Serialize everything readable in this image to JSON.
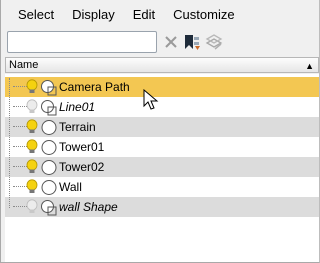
{
  "menu": [
    "Select",
    "Display",
    "Edit",
    "Customize"
  ],
  "search": {
    "value": ""
  },
  "header": {
    "name_label": "Name",
    "sort_icon": "sort-ascending-icon"
  },
  "rows": [
    {
      "name": "Camera Path",
      "italic": false,
      "selected": true,
      "light_on": true,
      "icon": "shape-object-icon"
    },
    {
      "name": "Line01",
      "italic": true,
      "selected": false,
      "light_on": false,
      "icon": "shape-object-icon"
    },
    {
      "name": "Terrain",
      "italic": false,
      "selected": false,
      "light_on": true,
      "icon": "geometry-object-icon"
    },
    {
      "name": "Tower01",
      "italic": false,
      "selected": false,
      "light_on": true,
      "icon": "geometry-object-icon"
    },
    {
      "name": "Tower02",
      "italic": false,
      "selected": false,
      "light_on": true,
      "icon": "geometry-object-icon"
    },
    {
      "name": "Wall",
      "italic": false,
      "selected": false,
      "light_on": true,
      "icon": "geometry-object-icon"
    },
    {
      "name": "wall Shape",
      "italic": true,
      "selected": false,
      "light_on": false,
      "icon": "shape-object-icon"
    }
  ],
  "colors": {
    "selected_row": "#f3c752",
    "alt_row": "#dcdcdc",
    "bulb_on": "#f5d20f"
  }
}
